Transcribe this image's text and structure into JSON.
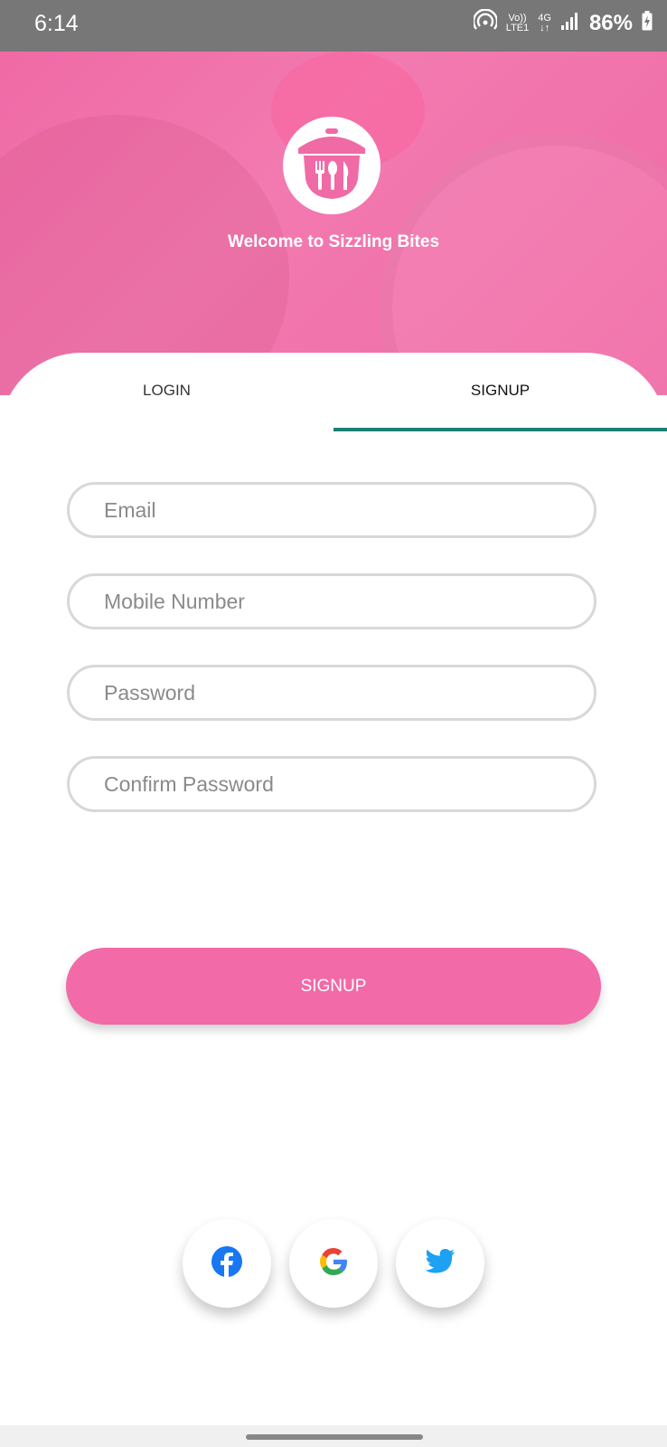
{
  "status_bar": {
    "time": "6:14",
    "volte": "Vo))",
    "lte": "LTE1",
    "network": "4G",
    "battery": "86%",
    "icons": [
      "hotspot-icon",
      "signal-icon",
      "battery-charging-icon"
    ]
  },
  "header": {
    "logo_icon": "cloche-cutlery-icon",
    "welcome_text": "Welcome to Sizzling Bites",
    "background_color": "#f06aa6"
  },
  "tabs": [
    {
      "label": "LOGIN",
      "active": false
    },
    {
      "label": "SIGNUP",
      "active": true
    }
  ],
  "form": {
    "email": {
      "placeholder": "Email",
      "value": ""
    },
    "mobile": {
      "placeholder": "Mobile Number",
      "value": ""
    },
    "password": {
      "placeholder": "Password",
      "value": ""
    },
    "confirm_password": {
      "placeholder": "Confirm Password",
      "value": ""
    },
    "submit_label": "SIGNUP"
  },
  "social": [
    {
      "name": "facebook",
      "icon": "facebook-icon",
      "color": "#1877f2"
    },
    {
      "name": "google",
      "icon": "google-icon",
      "color": "#4285f4"
    },
    {
      "name": "twitter",
      "icon": "twitter-icon",
      "color": "#1da1f2"
    }
  ],
  "colors": {
    "accent": "#f26aa8",
    "tab_indicator": "#1e7f73"
  }
}
